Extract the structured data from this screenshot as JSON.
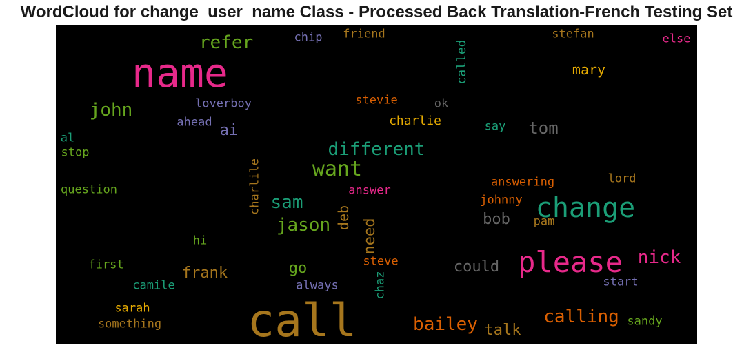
{
  "chart_data": {
    "type": "wordcloud",
    "title": "WordCloud for change_user_name Class - Processed Back Translation-French Testing Set",
    "background": "#000000",
    "words": [
      {
        "text": "name",
        "color": "#e7298a"
      },
      {
        "text": "call",
        "color": "#a6761d"
      },
      {
        "text": "please",
        "color": "#e7298a"
      },
      {
        "text": "change",
        "color": "#1b9e77"
      },
      {
        "text": "want",
        "color": "#66a61e"
      },
      {
        "text": "different",
        "color": "#1b9e77"
      },
      {
        "text": "john",
        "color": "#66a61e"
      },
      {
        "text": "refer",
        "color": "#66a61e"
      },
      {
        "text": "jason",
        "color": "#66a61e"
      },
      {
        "text": "sam",
        "color": "#1b9e77"
      },
      {
        "text": "bailey",
        "color": "#d95f02"
      },
      {
        "text": "calling",
        "color": "#d95f02"
      },
      {
        "text": "nick",
        "color": "#e7298a"
      },
      {
        "text": "mary",
        "color": "#e6ab02"
      },
      {
        "text": "tom",
        "color": "#666666"
      },
      {
        "text": "could",
        "color": "#666666"
      },
      {
        "text": "frank",
        "color": "#a6761d"
      },
      {
        "text": "go",
        "color": "#66a61e"
      },
      {
        "text": "bob",
        "color": "#666666"
      },
      {
        "text": "talk",
        "color": "#a6761d"
      },
      {
        "text": "ai",
        "color": "#7570b3"
      },
      {
        "text": "need",
        "color": "#a6761d"
      },
      {
        "text": "deb",
        "color": "#a6761d"
      },
      {
        "text": "charlie",
        "color": "#e6ab02"
      },
      {
        "text": "called",
        "color": "#1b9e77"
      },
      {
        "text": "loverboy",
        "color": "#7570b3"
      },
      {
        "text": "ahead",
        "color": "#7570b3"
      },
      {
        "text": "stevie",
        "color": "#d95f02"
      },
      {
        "text": "ok",
        "color": "#666666"
      },
      {
        "text": "say",
        "color": "#1b9e77"
      },
      {
        "text": "chip",
        "color": "#7570b3"
      },
      {
        "text": "friend",
        "color": "#a6761d"
      },
      {
        "text": "stefan",
        "color": "#a6761d"
      },
      {
        "text": "else",
        "color": "#e7298a"
      },
      {
        "text": "al",
        "color": "#1b9e77"
      },
      {
        "text": "stop",
        "color": "#66a61e"
      },
      {
        "text": "question",
        "color": "#66a61e"
      },
      {
        "text": "charlile",
        "color": "#a6761d"
      },
      {
        "text": "answer",
        "color": "#e7298a"
      },
      {
        "text": "answering",
        "color": "#d95f02"
      },
      {
        "text": "lord",
        "color": "#a6761d"
      },
      {
        "text": "johnny",
        "color": "#d95f02"
      },
      {
        "text": "pam",
        "color": "#a6761d"
      },
      {
        "text": "hi",
        "color": "#66a61e"
      },
      {
        "text": "first",
        "color": "#66a61e"
      },
      {
        "text": "camile",
        "color": "#1b9e77"
      },
      {
        "text": "steve",
        "color": "#d95f02"
      },
      {
        "text": "always",
        "color": "#7570b3"
      },
      {
        "text": "chaz",
        "color": "#1b9e77"
      },
      {
        "text": "start",
        "color": "#7570b3"
      },
      {
        "text": "sarah",
        "color": "#e6ab02"
      },
      {
        "text": "something",
        "color": "#a6761d"
      },
      {
        "text": "sandy",
        "color": "#66a61e"
      }
    ]
  }
}
